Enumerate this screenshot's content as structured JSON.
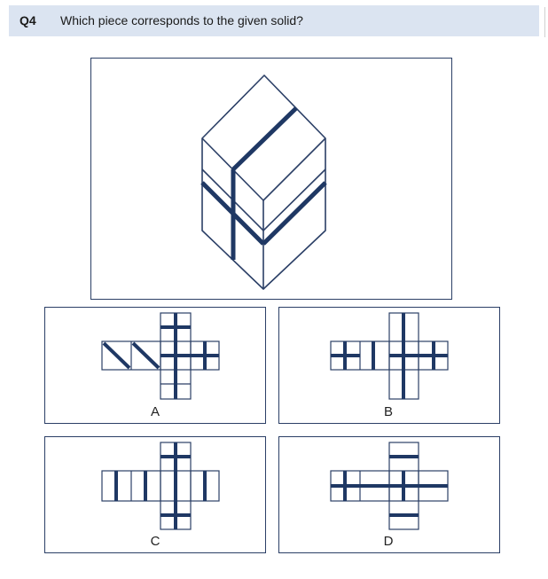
{
  "question": {
    "number": "Q4",
    "text": "Which piece corresponds to the given solid?"
  },
  "options": [
    {
      "label": "A"
    },
    {
      "label": "B"
    },
    {
      "label": "C"
    },
    {
      "label": "D"
    }
  ],
  "colors": {
    "header_bg": "#dbe4f1",
    "stroke": "#2b3f66",
    "stripe": "#1f3864"
  }
}
